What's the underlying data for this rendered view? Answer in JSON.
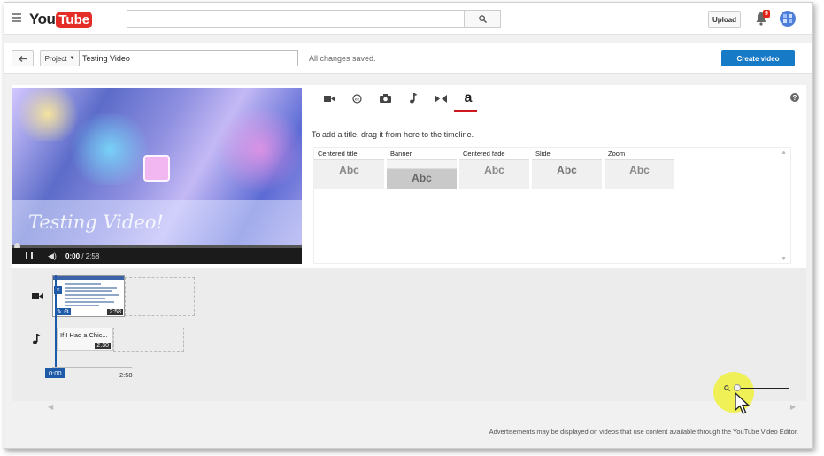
{
  "masthead": {
    "logo_you": "You",
    "logo_tube": "Tube",
    "search_placeholder": "",
    "upload_label": "Upload",
    "notification_count": "9"
  },
  "project_bar": {
    "project_label": "Project",
    "title_value": "Testing Video",
    "status": "All changes saved.",
    "create_label": "Create video"
  },
  "preview": {
    "overlay_title": "Testing Video!",
    "current_time": "0:00",
    "total_time": "/ 2:58"
  },
  "tabs": [
    {
      "name": "camera-icon",
      "glyph": "■"
    },
    {
      "name": "creative-commons-icon",
      "glyph": "◎"
    },
    {
      "name": "photo-icon",
      "glyph": "▣"
    },
    {
      "name": "music-icon",
      "glyph": "♪"
    },
    {
      "name": "transitions-icon",
      "glyph": "⋈"
    },
    {
      "name": "text-icon",
      "glyph": "a"
    }
  ],
  "text_panel": {
    "instructions": "To add a title, drag it from here to the timeline.",
    "styles": [
      {
        "name": "Centered title",
        "sample": "Abc"
      },
      {
        "name": "Banner",
        "sample": "Abc"
      },
      {
        "name": "Centered fade",
        "sample": "Abc"
      },
      {
        "name": "Slide",
        "sample": "Abc"
      },
      {
        "name": "Zoom",
        "sample": "Abc"
      }
    ]
  },
  "timeline": {
    "video_clip_duration": "2:58",
    "audio_clip_name": "If I Had a Chic...",
    "audio_clip_duration": "2:30",
    "start_time": "0:00",
    "end_time": "2:58"
  },
  "footer": {
    "notice": "Advertisements may be displayed on videos that use content available through the YouTube Video Editor."
  },
  "colors": {
    "brand_red": "#e52d27",
    "accent_blue": "#167ac6"
  }
}
